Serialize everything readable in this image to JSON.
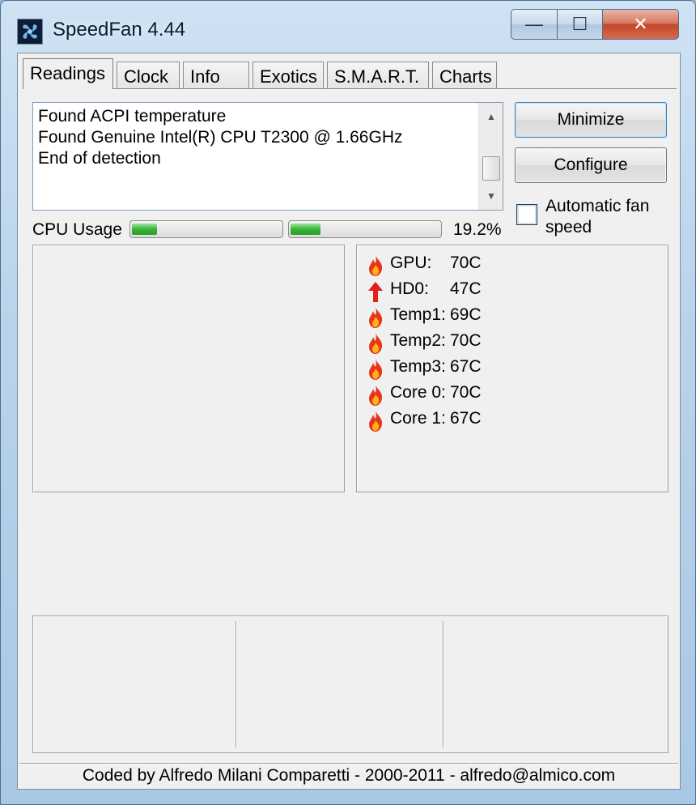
{
  "window": {
    "title": "SpeedFan 4.44",
    "icon": "speedfan-fan-icon",
    "controls": {
      "minimize": "—",
      "maximize": "☐",
      "close": "✕"
    }
  },
  "tabs": [
    {
      "label": "Readings",
      "active": true
    },
    {
      "label": "Clock"
    },
    {
      "label": "Info"
    },
    {
      "label": "Exotics"
    },
    {
      "label": "S.M.A.R.T."
    },
    {
      "label": "Charts"
    }
  ],
  "log": {
    "lines": [
      "Found ACPI temperature",
      "Found Genuine Intel(R) CPU T2300 @ 1.66GHz",
      "End of detection"
    ]
  },
  "buttons": {
    "minimize": "Minimize",
    "configure": "Configure"
  },
  "auto_fan": {
    "label": "Automatic fan speed",
    "checked": false
  },
  "cpu_usage": {
    "label": "CPU Usage",
    "percent_text": "19.2%",
    "core_fractions": [
      0.17,
      0.2
    ]
  },
  "readings": [
    {
      "name": "GPU:",
      "value": "70C",
      "icon": "flame-icon"
    },
    {
      "name": "HD0:",
      "value": "47C",
      "icon": "arrow-up-icon"
    },
    {
      "name": "Temp1:",
      "value": "69C",
      "icon": "flame-icon"
    },
    {
      "name": "Temp2:",
      "value": "70C",
      "icon": "flame-icon"
    },
    {
      "name": "Temp3:",
      "value": "67C",
      "icon": "flame-icon"
    },
    {
      "name": "Core 0:",
      "value": "70C",
      "icon": "flame-icon"
    },
    {
      "name": "Core 1:",
      "value": "67C",
      "icon": "flame-icon"
    }
  ],
  "status": {
    "text": "Coded by Alfredo Milani Comparetti - 2000-2011 - alfredo@almico.com"
  },
  "colors": {
    "flame": "#e8341a",
    "flame_core": "#ffb11a",
    "arrow": "#e0201a",
    "bar_fill": "#37b337"
  }
}
